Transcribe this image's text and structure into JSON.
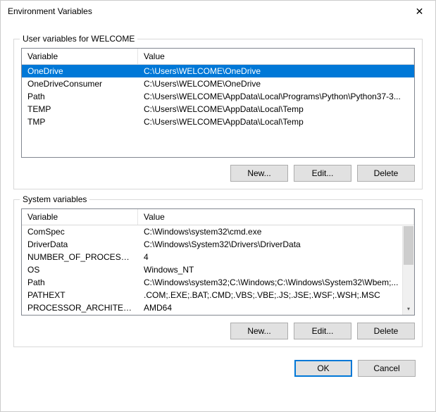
{
  "window": {
    "title": "Environment Variables"
  },
  "userVars": {
    "groupLabel": "User variables for WELCOME",
    "headers": {
      "variable": "Variable",
      "value": "Value"
    },
    "rows": [
      {
        "variable": "OneDrive",
        "value": "C:\\Users\\WELCOME\\OneDrive",
        "selected": true
      },
      {
        "variable": "OneDriveConsumer",
        "value": "C:\\Users\\WELCOME\\OneDrive",
        "selected": false
      },
      {
        "variable": "Path",
        "value": "C:\\Users\\WELCOME\\AppData\\Local\\Programs\\Python\\Python37-3...",
        "selected": false
      },
      {
        "variable": "TEMP",
        "value": "C:\\Users\\WELCOME\\AppData\\Local\\Temp",
        "selected": false
      },
      {
        "variable": "TMP",
        "value": "C:\\Users\\WELCOME\\AppData\\Local\\Temp",
        "selected": false
      }
    ],
    "buttons": {
      "new": "New...",
      "edit": "Edit...",
      "delete": "Delete"
    }
  },
  "sysVars": {
    "groupLabel": "System variables",
    "headers": {
      "variable": "Variable",
      "value": "Value"
    },
    "rows": [
      {
        "variable": "ComSpec",
        "value": "C:\\Windows\\system32\\cmd.exe",
        "selected": false
      },
      {
        "variable": "DriverData",
        "value": "C:\\Windows\\System32\\Drivers\\DriverData",
        "selected": false
      },
      {
        "variable": "NUMBER_OF_PROCESSORS",
        "value": "4",
        "selected": false
      },
      {
        "variable": "OS",
        "value": "Windows_NT",
        "selected": false
      },
      {
        "variable": "Path",
        "value": "C:\\Windows\\system32;C:\\Windows;C:\\Windows\\System32\\Wbem;...",
        "selected": false
      },
      {
        "variable": "PATHEXT",
        "value": ".COM;.EXE;.BAT;.CMD;.VBS;.VBE;.JS;.JSE;.WSF;.WSH;.MSC",
        "selected": false
      },
      {
        "variable": "PROCESSOR_ARCHITECTURE",
        "value": "AMD64",
        "selected": false
      }
    ],
    "buttons": {
      "new": "New...",
      "edit": "Edit...",
      "delete": "Delete"
    }
  },
  "dialog": {
    "ok": "OK",
    "cancel": "Cancel"
  }
}
